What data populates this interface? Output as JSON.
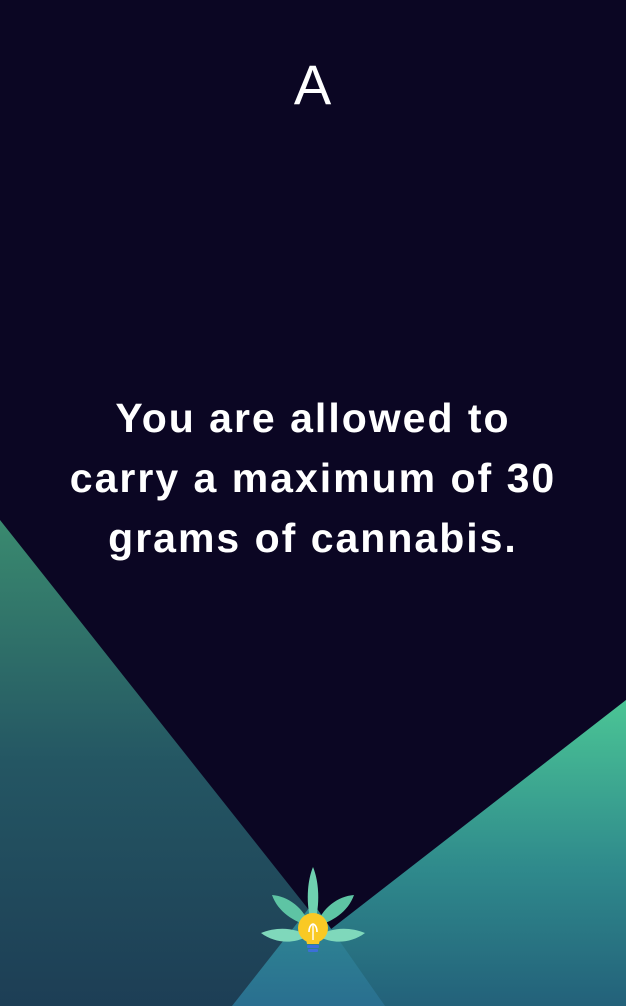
{
  "card": {
    "letter": "A",
    "statement": "You are allowed to carry a maximum of 30 grams of cannabis."
  },
  "icons": {
    "tip": "cannabis-leaf-lightbulb-icon"
  },
  "colors": {
    "background": "#0b0623",
    "green_accent": "#48c193",
    "teal_deep": "#1e4a5e",
    "text": "#ffffff",
    "bulb": "#f9c924"
  }
}
